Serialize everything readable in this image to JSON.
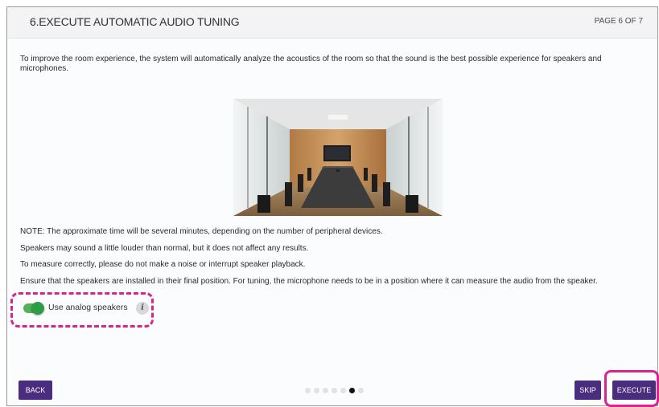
{
  "header": {
    "title": "6.EXECUTE AUTOMATIC AUDIO TUNING",
    "page_indicator": "PAGE 6 OF 7"
  },
  "intro": "To improve the room experience, the system will automatically analyze the acoustics of the room so that the sound is the best possible experience for speakers and microphones.",
  "image": {
    "name": "conference-room-photo"
  },
  "notes": [
    "NOTE: The approximate time will be several minutes, depending on the number of peripheral devices.",
    "Speakers may sound a little louder than normal, but it does not affect any results.",
    "To measure correctly, please do not make a noise or interrupt speaker playback.",
    "Ensure that the speakers are installed in their final position. For tuning, the microphone needs to be in a position where it can measure the audio from the speaker."
  ],
  "toggle": {
    "label": "Use analog speakers",
    "checked": true,
    "info_glyph": "i"
  },
  "footer": {
    "back_label": "BACK",
    "skip_label": "SKIP",
    "execute_label": "EXECUTE",
    "pagination": {
      "total": 7,
      "current": 6
    }
  },
  "colors": {
    "button": "#4b2d7f",
    "toggle_on": "#2e9c46",
    "highlight": "#d6258d",
    "header_bg": "#f3f3f6"
  },
  "icons": {
    "info": "info-icon"
  }
}
